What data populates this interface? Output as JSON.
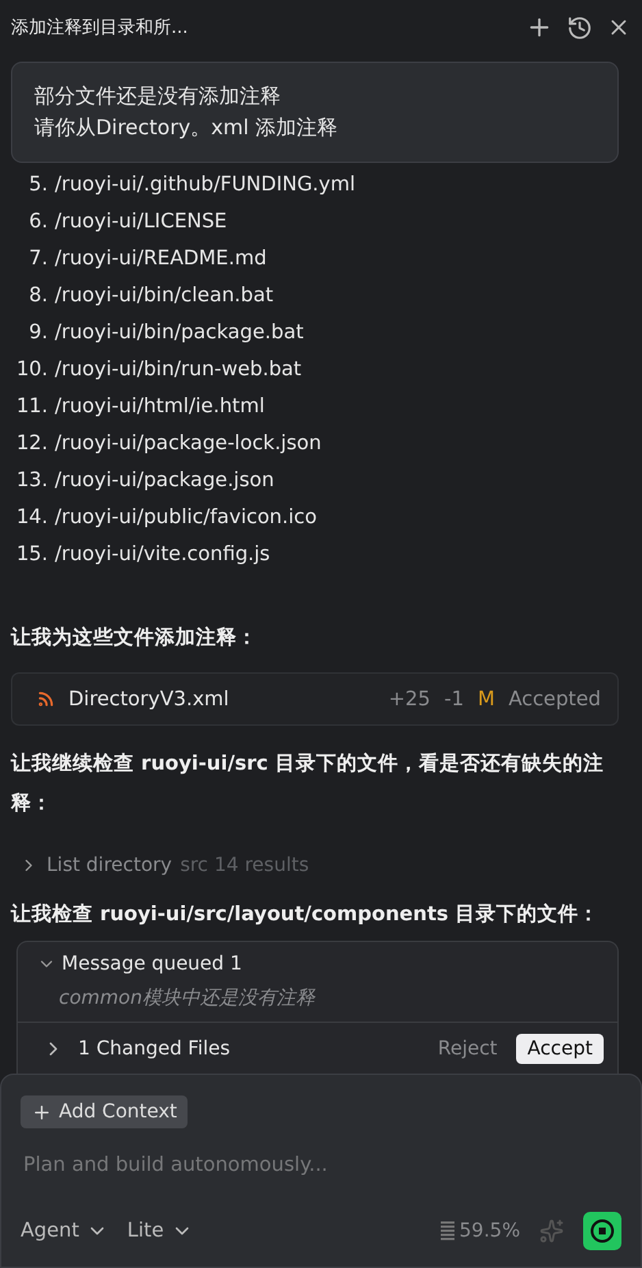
{
  "header": {
    "title": "添加注释到目录和所..."
  },
  "user_message": {
    "lines": [
      "部分文件还是没有添加注释",
      "请你从Directory。xml 添加注释"
    ]
  },
  "file_list": [
    {
      "number": "5.",
      "path": "/ruoyi-ui/.github/FUNDING.yml"
    },
    {
      "number": "6.",
      "path": "/ruoyi-ui/LICENSE"
    },
    {
      "number": "7.",
      "path": "/ruoyi-ui/README.md"
    },
    {
      "number": "8.",
      "path": "/ruoyi-ui/bin/clean.bat"
    },
    {
      "number": "9.",
      "path": "/ruoyi-ui/bin/package.bat"
    },
    {
      "number": "10.",
      "path": "/ruoyi-ui/bin/run-web.bat"
    },
    {
      "number": "11.",
      "path": "/ruoyi-ui/html/ie.html"
    },
    {
      "number": "12.",
      "path": "/ruoyi-ui/package-lock.json"
    },
    {
      "number": "13.",
      "path": "/ruoyi-ui/package.json"
    },
    {
      "number": "14.",
      "path": "/ruoyi-ui/public/favicon.ico"
    },
    {
      "number": "15.",
      "path": "/ruoyi-ui/vite.config.js"
    }
  ],
  "paragraph_1": "让我为这些文件添加注释：",
  "file_change": {
    "name": "DirectoryV3.xml",
    "added": "+25",
    "removed": "-1",
    "status_letter": "M",
    "status": "Accepted"
  },
  "paragraph_2": "让我继续检查 ruoyi-ui/src 目录下的文件，看是否还有缺失的注释：",
  "tool_call": {
    "label": "List directory",
    "detail": "src 14 results",
    "expanded": false
  },
  "paragraph_3": "让我检查 ruoyi-ui/src/layout/components 目录下的文件：",
  "queue": {
    "title": "Message queued 1",
    "expanded": true,
    "message": "common模块中还是没有注释"
  },
  "changes": {
    "label": "1 Changed Files",
    "reject": "Reject",
    "accept": "Accept"
  },
  "composer": {
    "add_context": "Add Context",
    "placeholder": "Plan and build autonomously...",
    "mode": "Agent",
    "model": "Lite",
    "usage": "59.5%"
  }
}
